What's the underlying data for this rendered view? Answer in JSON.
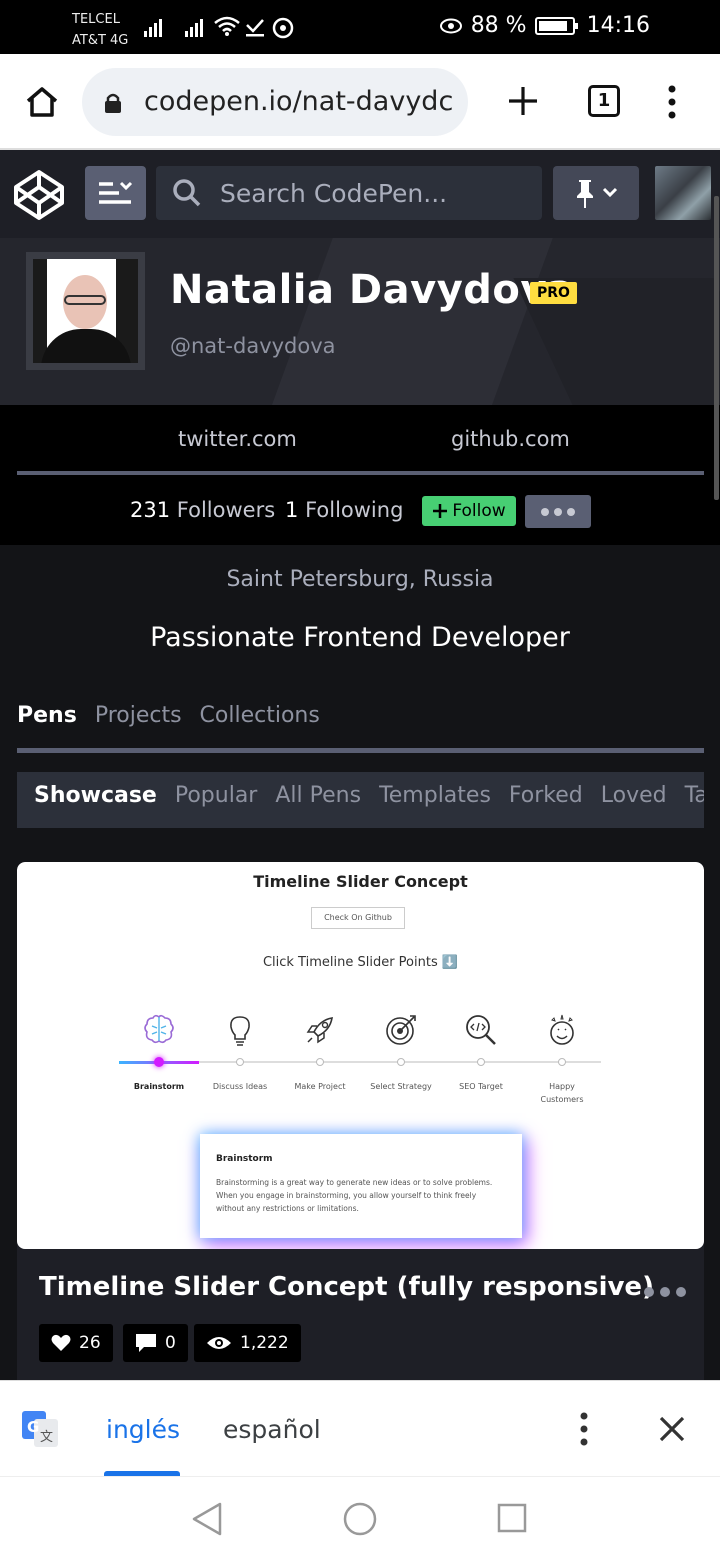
{
  "status_bar": {
    "carrier_1": "TELCEL",
    "carrier_2": "AT&T 4G",
    "battery": "88 %",
    "time": "14:16"
  },
  "browser": {
    "url": "codepen.io/nat-davydc",
    "tab_count": "1"
  },
  "header": {
    "search_placeholder": "Search CodePen..."
  },
  "profile": {
    "name": "Natalia Davydova",
    "badge": "PRO",
    "handle": "@nat-davydova",
    "links": [
      "twitter.com",
      "github.com"
    ],
    "followers_count": "231",
    "followers_label": "Followers",
    "following_count": "1",
    "following_label": "Following",
    "follow_label": "Follow",
    "location": "Saint Petersburg, Russia",
    "bio": "Passionate Frontend Developer"
  },
  "tabs": [
    {
      "label": "Pens",
      "active": true
    },
    {
      "label": "Projects",
      "active": false
    },
    {
      "label": "Collections",
      "active": false
    }
  ],
  "subtabs": [
    {
      "label": "Showcase",
      "active": true
    },
    {
      "label": "Popular",
      "active": false
    },
    {
      "label": "All Pens",
      "active": false
    },
    {
      "label": "Templates",
      "active": false
    },
    {
      "label": "Forked",
      "active": false
    },
    {
      "label": "Loved",
      "active": false
    },
    {
      "label": "Tags",
      "active": false
    }
  ],
  "pen": {
    "title": "Timeline Slider Concept (fully responsive)",
    "likes": "26",
    "comments": "0",
    "views": "1,222",
    "preview": {
      "title": "Timeline Slider Concept",
      "button": "Check On Github",
      "hint": "Click Timeline Slider Points ⬇️",
      "steps": [
        {
          "label": "Brainstorm",
          "icon": "brain-icon"
        },
        {
          "label": "Discuss Ideas",
          "icon": "lightbulb-icon"
        },
        {
          "label": "Make Project",
          "icon": "rocket-icon"
        },
        {
          "label": "Select Strategy",
          "icon": "target-icon"
        },
        {
          "label": "SEO Target",
          "icon": "magnifier-code-icon"
        },
        {
          "label": "Happy Customers",
          "icon": "happy-face-icon"
        }
      ],
      "popup_title": "Brainstorm",
      "popup_text": "Brainstorming is a great way to generate new ideas or to solve problems. When you engage in brainstorming, you allow yourself to think freely without any restrictions or limitations."
    }
  },
  "translate_bar": {
    "active_language": "inglés",
    "other_language": "español"
  },
  "colors": {
    "follow_green": "#47cf73",
    "pro_yellow": "#ffdd40",
    "translate_blue": "#1a73e8",
    "bg_dark": "#131417"
  }
}
